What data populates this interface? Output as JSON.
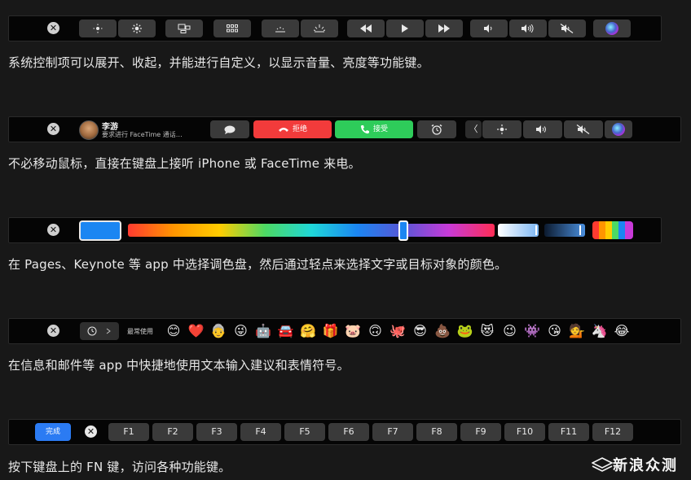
{
  "bar1": {
    "keys": [
      "☼",
      "✺",
      "▭▢",
      "▦",
      "⋰⋱",
      "⋰⋱",
      "⏪",
      "▶",
      "⏩",
      "◁",
      "◁))",
      "◁x"
    ]
  },
  "caption1": "系统控制项可以展开、收起，并能进行自定义，以显示音量、亮度等功能键。",
  "bar2": {
    "caller_name": "李游",
    "caller_sub": "要求进行 FaceTime 通话…",
    "decline_label": "拒绝",
    "accept_label": "接受",
    "chevron": "〈"
  },
  "caption2": "不必移动鼠标，直接在键盘上接听 iPhone 或 FaceTime 来电。",
  "caption3": "在 Pages、Keynote 等 app 中选择调色盘，然后通过轻点来选择文字或目标对象的颜色。",
  "bar4": {
    "recent_label": "最常使用",
    "emojis": [
      "😊",
      "❤️",
      "👵",
      "😜",
      "🤖",
      "🚘",
      "🤗",
      "🎁",
      "🐷",
      "🙃",
      "🐙",
      "😎",
      "💩",
      "🐸",
      "😻",
      "😉",
      "👾",
      "😘",
      "💁",
      "🦄",
      "😂"
    ]
  },
  "caption4": "在信息和邮件等 app 中快捷地使用文本输入建议和表情符号。",
  "bar5": {
    "done_label": "完成",
    "fkeys": [
      "F1",
      "F2",
      "F3",
      "F4",
      "F5",
      "F6",
      "F7",
      "F8",
      "F9",
      "F10",
      "F11",
      "F12"
    ]
  },
  "caption5": "按下键盘上的 FN 键，访问各种功能键。",
  "watermark": "新浪众测"
}
